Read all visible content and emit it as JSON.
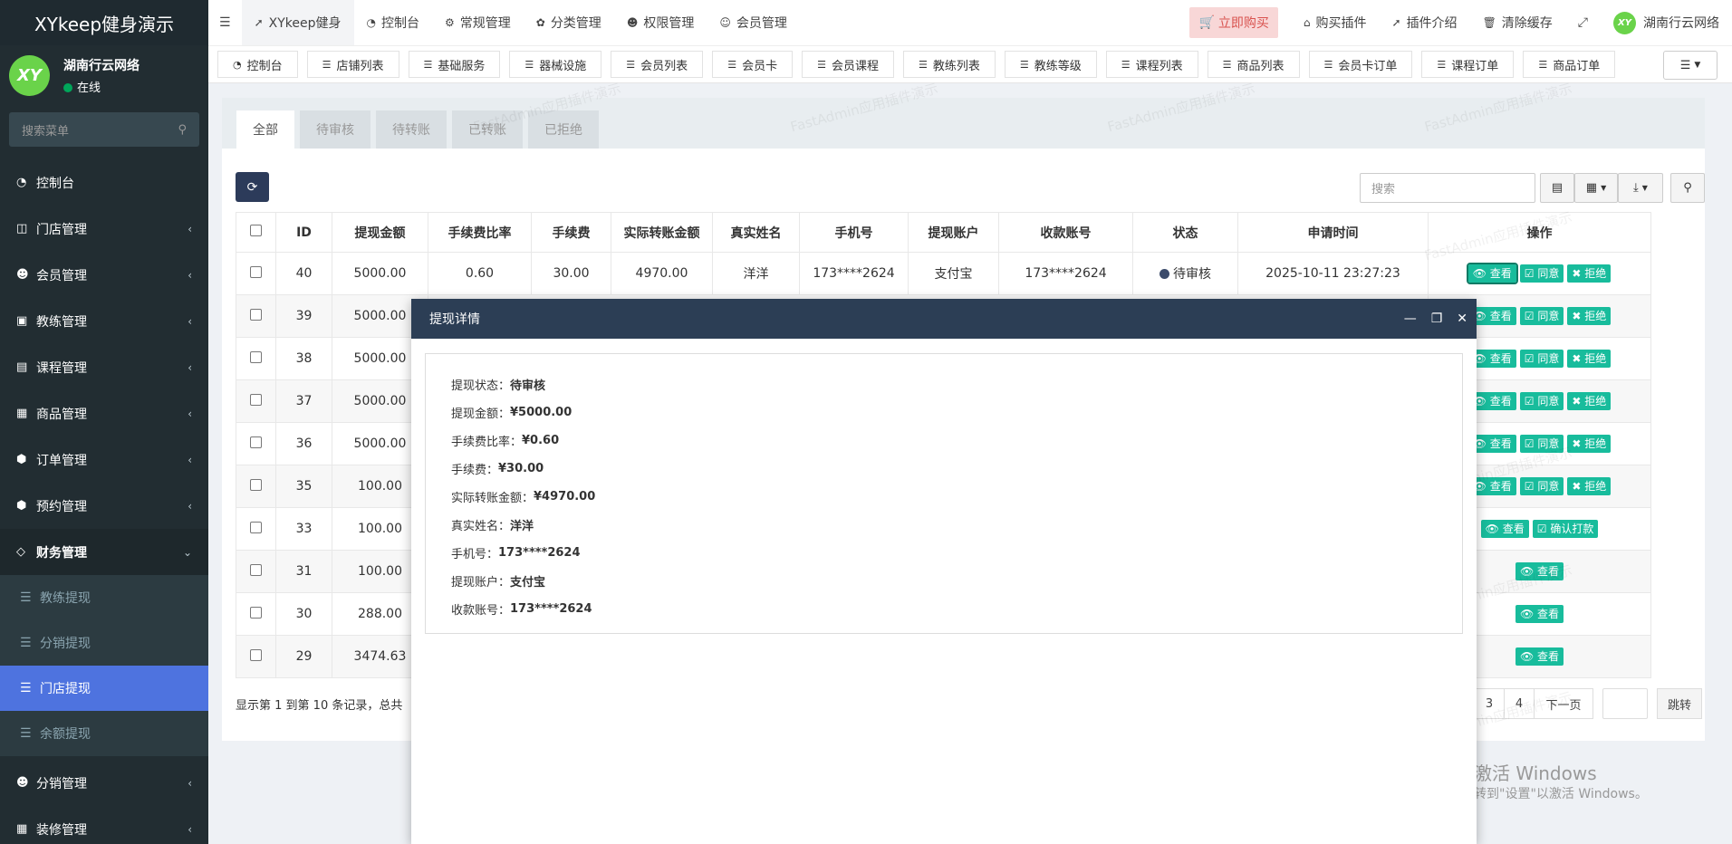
{
  "sidebar": {
    "brand": "XYkeep健身演示",
    "user_name": "湖南行云网络",
    "user_status": "在线",
    "avatar_text": "XY",
    "search_placeholder": "搜索菜单",
    "items": [
      {
        "label": "控制台"
      },
      {
        "label": "门店管理"
      },
      {
        "label": "会员管理"
      },
      {
        "label": "教练管理"
      },
      {
        "label": "课程管理"
      },
      {
        "label": "商品管理"
      },
      {
        "label": "订单管理"
      },
      {
        "label": "预约管理"
      },
      {
        "label": "财务管理"
      },
      {
        "label": "教练提现"
      },
      {
        "label": "分销提现"
      },
      {
        "label": "门店提现"
      },
      {
        "label": "余额提现"
      },
      {
        "label": "分销管理"
      },
      {
        "label": "装修管理"
      }
    ]
  },
  "topnav": {
    "items": [
      "XYkeep健身",
      "控制台",
      "常规管理",
      "分类管理",
      "权限管理",
      "会员管理"
    ],
    "buy": "立即购买",
    "right": [
      "购买插件",
      "插件介绍",
      "清除缓存"
    ],
    "user": "湖南行云网络"
  },
  "tabs": [
    "控制台",
    "店铺列表",
    "基础服务",
    "器械设施",
    "会员列表",
    "会员卡",
    "会员课程",
    "教练列表",
    "教练等级",
    "课程列表",
    "商品列表",
    "会员卡订单",
    "课程订单",
    "商品订单"
  ],
  "panel": {
    "status_tabs": [
      "全部",
      "待审核",
      "待转账",
      "已转账",
      "已拒绝"
    ],
    "search_placeholder": "搜索"
  },
  "table": {
    "headers": [
      "ID",
      "提现金额",
      "手续费比率",
      "手续费",
      "实际转账金额",
      "真实姓名",
      "手机号",
      "提现账户",
      "收款账号",
      "状态",
      "申请时间",
      "操作"
    ],
    "first_row": {
      "id": "40",
      "amount": "5000.00",
      "rate": "0.60",
      "fee": "30.00",
      "actual": "4970.00",
      "name": "洋洋",
      "phone": "173****2624",
      "account": "支付宝",
      "receive": "173****2624",
      "status": "待审核",
      "time": "2025-10-11 23:27:23"
    },
    "rows": [
      {
        "id": "39",
        "amount": "5000.00"
      },
      {
        "id": "38",
        "amount": "5000.00"
      },
      {
        "id": "37",
        "amount": "5000.00"
      },
      {
        "id": "36",
        "amount": "5000.00"
      },
      {
        "id": "35",
        "amount": "100.00"
      },
      {
        "id": "33",
        "amount": "100.00"
      },
      {
        "id": "31",
        "amount": "100.00"
      },
      {
        "id": "30",
        "amount": "288.00"
      },
      {
        "id": "29",
        "amount": "3474.63"
      }
    ],
    "btn_view": "查看",
    "btn_agree": "同意",
    "btn_reject": "拒绝",
    "btn_confirm": "确认打款"
  },
  "footer": {
    "summary": "显示第 1 到第 10 条记录，总共",
    "pages": [
      "3",
      "4"
    ],
    "next": "下一页",
    "jump": "跳转"
  },
  "modal": {
    "title": "提现详情",
    "lines": [
      {
        "label": "提现状态：",
        "value": "待审核"
      },
      {
        "label": "提现金额：",
        "value": "¥5000.00"
      },
      {
        "label": "手续费比率：",
        "value": "¥0.60"
      },
      {
        "label": "手续费：",
        "value": "¥30.00"
      },
      {
        "label": "实际转账金额：",
        "value": "¥4970.00"
      },
      {
        "label": "真实姓名：",
        "value": "洋洋"
      },
      {
        "label": "手机号：",
        "value": "173****2624"
      },
      {
        "label": "提现账户：",
        "value": "支付宝"
      },
      {
        "label": "收款账号：",
        "value": "173****2624"
      }
    ]
  },
  "watermark": "FastAdmin应用插件演示",
  "windows": {
    "line1": "激活 Windows",
    "line2": "转到\"设置\"以激活 Windows。"
  }
}
